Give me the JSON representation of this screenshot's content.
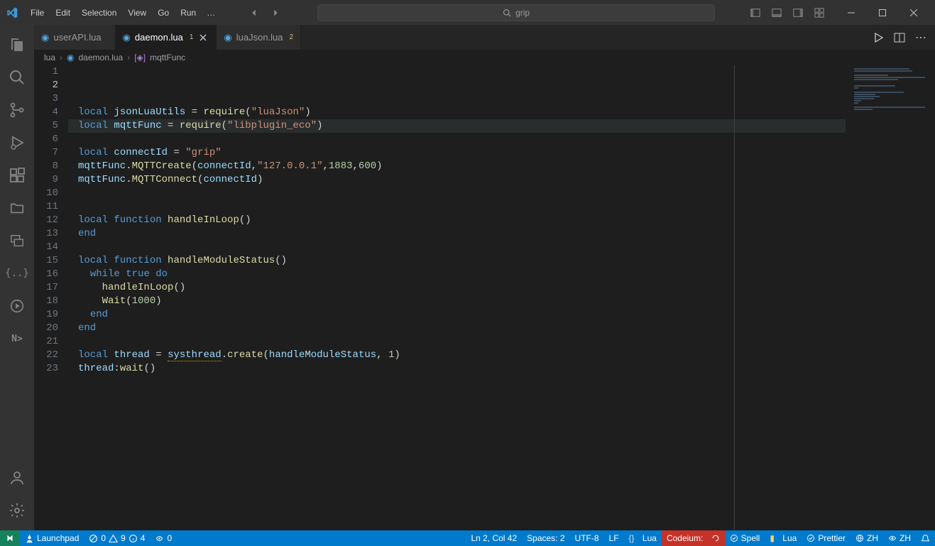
{
  "menubar": {
    "items": [
      "File",
      "Edit",
      "Selection",
      "View",
      "Go",
      "Run"
    ],
    "overflow": "…"
  },
  "search": {
    "placeholder": "grip"
  },
  "tabs": [
    {
      "file": "userAPI.lua",
      "active": false,
      "modified": ""
    },
    {
      "file": "daemon.lua",
      "active": true,
      "modified": "1"
    },
    {
      "file": "luaJson.lua",
      "active": false,
      "modified": "2"
    }
  ],
  "breadcrumbs": {
    "seg0": "lua",
    "seg1": "daemon.lua",
    "seg2": "mqttFunc"
  },
  "editor": {
    "line_count": 23,
    "active_line": 2,
    "ruler_col": 120
  },
  "code": {
    "lines": [
      [
        [
          "local",
          "kw"
        ],
        [
          " ",
          "punc"
        ],
        [
          "jsonLuaUtils",
          "id"
        ],
        [
          " = ",
          "punc"
        ],
        [
          "require",
          "fn"
        ],
        [
          "(",
          "punc"
        ],
        [
          "\"luaJson\"",
          "str"
        ],
        [
          ")",
          "punc"
        ]
      ],
      [
        [
          "local",
          "kw"
        ],
        [
          " ",
          "punc"
        ],
        [
          "mqttFunc",
          "id"
        ],
        [
          " = ",
          "punc"
        ],
        [
          "require",
          "fn"
        ],
        [
          "(",
          "punc"
        ],
        [
          "\"libplugin_eco\"",
          "str"
        ],
        [
          ")",
          "punc"
        ]
      ],
      [],
      [
        [
          "local",
          "kw"
        ],
        [
          " ",
          "punc"
        ],
        [
          "connectId",
          "id"
        ],
        [
          " = ",
          "punc"
        ],
        [
          "\"grip\"",
          "str"
        ]
      ],
      [
        [
          "mqttFunc",
          "id"
        ],
        [
          ".",
          "punc"
        ],
        [
          "MQTTCreate",
          "call"
        ],
        [
          "(",
          "punc"
        ],
        [
          "connectId",
          "id"
        ],
        [
          ",",
          "punc"
        ],
        [
          "\"127.0.0.1\"",
          "str"
        ],
        [
          ",",
          "punc"
        ],
        [
          "1883",
          "num"
        ],
        [
          ",",
          "punc"
        ],
        [
          "600",
          "num"
        ],
        [
          ")",
          "punc"
        ]
      ],
      [
        [
          "mqttFunc",
          "id"
        ],
        [
          ".",
          "punc"
        ],
        [
          "MQTTConnect",
          "call"
        ],
        [
          "(",
          "punc"
        ],
        [
          "connectId",
          "id"
        ],
        [
          ")",
          "punc"
        ]
      ],
      [],
      [],
      [
        [
          "local",
          "kw"
        ],
        [
          " ",
          "punc"
        ],
        [
          "function",
          "kw"
        ],
        [
          " ",
          "punc"
        ],
        [
          "handleInLoop",
          "call"
        ],
        [
          "()",
          "punc"
        ]
      ],
      [
        [
          "end",
          "kw"
        ]
      ],
      [],
      [
        [
          "local",
          "kw"
        ],
        [
          " ",
          "punc"
        ],
        [
          "function",
          "kw"
        ],
        [
          " ",
          "punc"
        ],
        [
          "handleModuleStatus",
          "call"
        ],
        [
          "()",
          "punc"
        ]
      ],
      [
        [
          "  ",
          "punc"
        ],
        [
          "while",
          "kw"
        ],
        [
          " ",
          "punc"
        ],
        [
          "true",
          "kw"
        ],
        [
          " ",
          "punc"
        ],
        [
          "do",
          "kw"
        ]
      ],
      [
        [
          "    ",
          "punc"
        ],
        [
          "handleInLoop",
          "call"
        ],
        [
          "()",
          "punc"
        ]
      ],
      [
        [
          "    ",
          "punc"
        ],
        [
          "Wait",
          "call"
        ],
        [
          "(",
          "punc"
        ],
        [
          "1000",
          "num"
        ],
        [
          ")",
          "punc"
        ]
      ],
      [
        [
          "  ",
          "punc"
        ],
        [
          "end",
          "kw"
        ]
      ],
      [
        [
          "end",
          "kw"
        ]
      ],
      [],
      [
        [
          "local",
          "kw"
        ],
        [
          " ",
          "punc"
        ],
        [
          "thread",
          "id"
        ],
        [
          " = ",
          "punc"
        ],
        [
          "systhread",
          "id warn"
        ],
        [
          ".",
          "punc"
        ],
        [
          "create",
          "call"
        ],
        [
          "(",
          "punc"
        ],
        [
          "handleModuleStatus",
          "id"
        ],
        [
          ", ",
          "punc"
        ],
        [
          "1",
          "num"
        ],
        [
          ")",
          "punc"
        ]
      ],
      [
        [
          "thread",
          "id"
        ],
        [
          ":",
          "punc"
        ],
        [
          "wait",
          "call"
        ],
        [
          "()",
          "punc"
        ]
      ],
      [],
      [],
      []
    ]
  },
  "statusbar": {
    "launchpad": "Launchpad",
    "errors": "0",
    "warnings": "9",
    "infos": "4",
    "ports": "0",
    "pos": "Ln 2, Col 42",
    "spaces": "Spaces: 2",
    "encoding": "UTF-8",
    "eol": "LF",
    "lang": "Lua",
    "codeium": "Codeium:",
    "spell": "Spell",
    "luals": "Lua",
    "prettier": "Prettier",
    "ime1": "ZH",
    "ime2": "ZH"
  }
}
